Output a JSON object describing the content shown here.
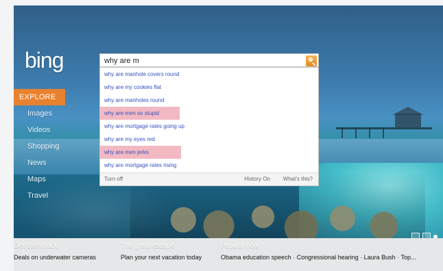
{
  "brand": {
    "logo_text": "bing"
  },
  "nav": {
    "items": [
      {
        "label": "EXPLORE"
      },
      {
        "label": "Images"
      },
      {
        "label": "Videos"
      },
      {
        "label": "Shopping"
      },
      {
        "label": "News"
      },
      {
        "label": "Maps"
      },
      {
        "label": "Travel"
      }
    ]
  },
  "search": {
    "query": "why are m",
    "suggestions": [
      {
        "text": "why are manhole covers round"
      },
      {
        "text": "why are my cookies flat"
      },
      {
        "text": "why are manholes round"
      },
      {
        "text": "why are men so stupid",
        "highlight": true
      },
      {
        "text": "why are mortgage rates going up"
      },
      {
        "text": "why are my eyes red"
      },
      {
        "text": "why are men jerks",
        "highlight": true
      },
      {
        "text": "why are mortgage rates rising"
      }
    ],
    "footer": {
      "turn_off": "Turn off",
      "history": "History On",
      "whats_this": "What's this?"
    }
  },
  "bottom": {
    "col1": {
      "head": "Get cash back",
      "text": "Deals on underwater cameras"
    },
    "col2": {
      "head": "The great escape",
      "text": "Plan your next vacation today"
    },
    "col3": {
      "head": "Popular now",
      "text": "Obama education speech · Congressional hearing · Laura Bush · Top..."
    }
  },
  "colors": {
    "explore_bg": "#e9822e",
    "suggestion_text": "#3451c0",
    "highlight_bg": "#f2b9c3",
    "search_button": "#e58a1e"
  },
  "icons": {
    "search_button_icon": "magnifier-icon",
    "tile_icons": [
      "square-icon",
      "square-icon",
      "dot-icon"
    ]
  }
}
